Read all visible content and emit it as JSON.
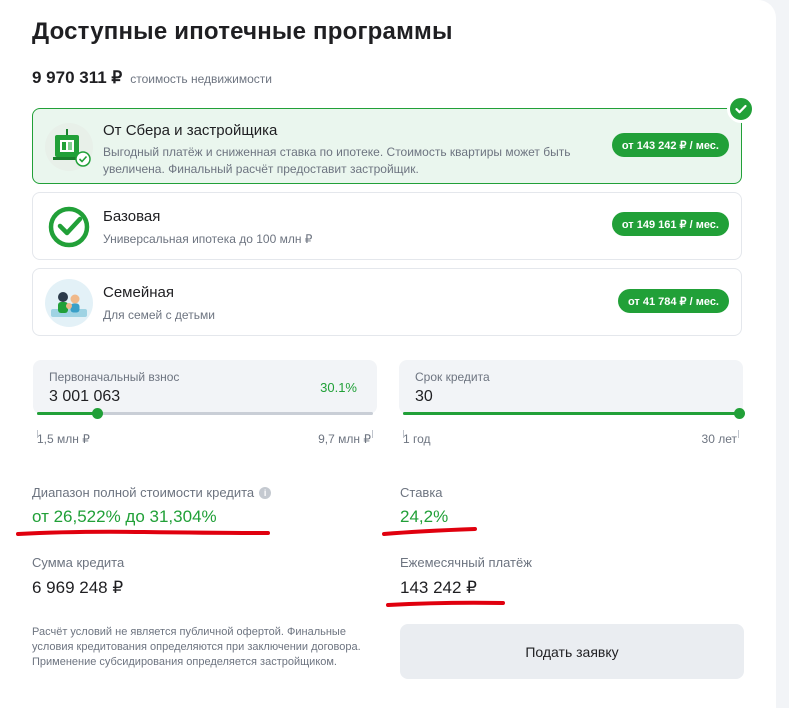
{
  "page": {
    "title": "Доступные ипотечные программы",
    "property_price": "9 970 311 ₽",
    "property_price_caption": "стоимость недвижимости"
  },
  "programs": [
    {
      "title": "От Сбера и застройщика",
      "description": "Выгодный платёж и сниженная ставка по ипотеке. Стоимость квартиры может быть увеличена. Финальный расчёт предоставит застройщик.",
      "payment": "от 143 242 ₽ / мес.",
      "selected": true,
      "icon": "developer-building-icon"
    },
    {
      "title": "Базовая",
      "description": "Универсальная ипотека до 100 млн ₽",
      "payment": "от 149 161 ₽ / мес.",
      "selected": false,
      "icon": "sber-check-icon"
    },
    {
      "title": "Семейная",
      "description": "Для семей с детьми",
      "payment": "от 41 784 ₽ / мес.",
      "selected": false,
      "icon": "family-icon"
    }
  ],
  "down_payment": {
    "label": "Первоначальный взнос",
    "value": "3 001 063",
    "percent": "30.1%",
    "min_label": "1,5 млн ₽",
    "max_label": "9,7 млн ₽",
    "fill_fraction": 0.18
  },
  "term": {
    "label": "Срок кредита",
    "value": "30",
    "min_label": "1 год",
    "max_label": "30 лет",
    "fill_fraction": 1.0
  },
  "stats": {
    "psk_label": "Диапазон полной стоимости кредита",
    "psk_value": "от 26,522% до 31,304%",
    "rate_label": "Ставка",
    "rate_value": "24,2%",
    "loan_label": "Сумма кредита",
    "loan_value": "6 969 248 ₽",
    "monthly_label": "Ежемесячный платёж",
    "monthly_value": "143 242 ₽"
  },
  "disclaimer": "Расчёт условий не является публичной офертой. Финальные условия кредитования определяются при заключении договора. Применение субсидирования определяется застройщиком.",
  "submit_label": "Подать заявку",
  "colors": {
    "accent": "#21a038",
    "annotation": "#e0000e"
  }
}
